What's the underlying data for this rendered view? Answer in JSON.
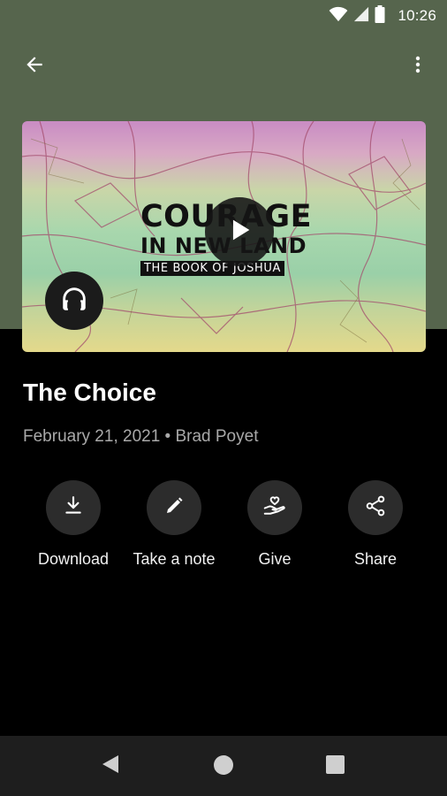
{
  "status_bar": {
    "time": "10:26",
    "icons": [
      "wifi-icon",
      "cell-signal-icon",
      "battery-icon"
    ]
  },
  "top_bar": {
    "back_icon": "arrow-back-icon",
    "more_icon": "more-vert-icon"
  },
  "artwork": {
    "line1": "COURAGE",
    "line2": "IN NEW LAND",
    "line3": "THE BOOK OF JOSHUA",
    "play_icon": "play-icon",
    "audio_icon": "headphones-icon"
  },
  "sermon": {
    "title": "The Choice",
    "meta": "February 21, 2021 • Brad Poyet"
  },
  "actions": [
    {
      "label": "Download",
      "icon": "download-icon"
    },
    {
      "label": "Take a note",
      "icon": "pencil-icon"
    },
    {
      "label": "Give",
      "icon": "give-hand-heart-icon"
    },
    {
      "label": "Share",
      "icon": "share-icon"
    }
  ],
  "nav_bar": {
    "icons": [
      "nav-back-icon",
      "nav-home-icon",
      "nav-recents-icon"
    ]
  },
  "colors": {
    "header_bg": "#56654d",
    "page_bg": "#000000",
    "action_circle": "#2c2c2c",
    "meta_text": "#a9a9a9",
    "nav_bar_bg": "#1e1e1e"
  }
}
